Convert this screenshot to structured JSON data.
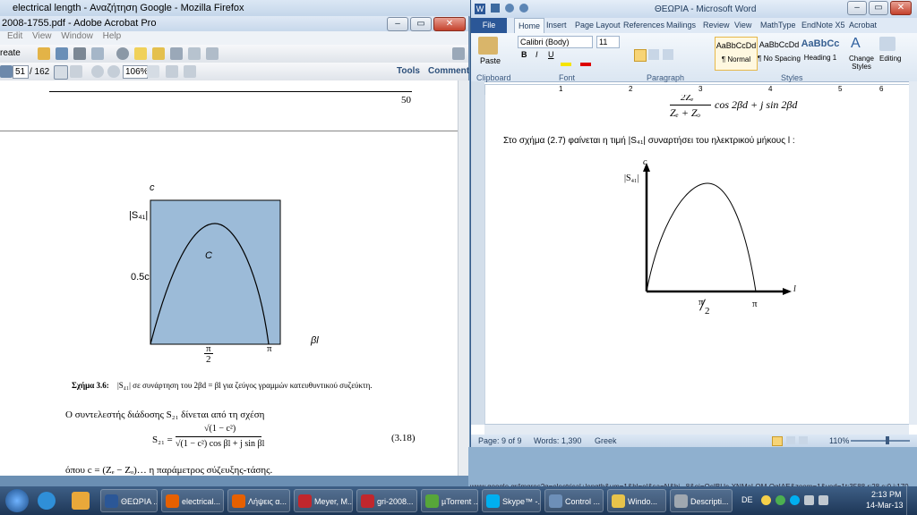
{
  "firefox": {
    "title": "electrical length - Αναζήτηση Google - Mozilla Firefox"
  },
  "acrobat": {
    "title": "2008-1755.pdf - Adobe Acrobat Pro",
    "menu": [
      "Edit",
      "View",
      "Window",
      "Help"
    ],
    "create_label": "reate",
    "page_current": "51",
    "page_total": "/ 162",
    "zoom": "106%",
    "tools_label": "Tools",
    "comment_label": "Comment",
    "page_number": "50",
    "figure": {
      "ylabel_c": "c",
      "ytick_s41": "|S₄₁|",
      "ytick_half": "0.5c",
      "curve_label": "C",
      "xtick_pi2_top": "π",
      "xtick_pi2_bottom": "2",
      "xtick_pi": "π",
      "xlabel": "βl",
      "fill_color": "#9cbbd8"
    },
    "caption_bold": "Σχήμα 3.6:",
    "caption_rest": "|S₄₁| σε συνάρτηση του  2βd = βl  για ζεύγος γραμμών κατευθυντικού συζεύκτη.",
    "para1": "Ο συντελεστής διάδοσης S₂₁ δίνεται από τη σχέση",
    "eq_lhs": "S₂₁ =",
    "eq_num": "√(1 − c²)",
    "eq_den": "√(1 − c²) cos βl + j sin βl",
    "eq_no": "(3.18)",
    "para2": "όπου  c = (Zₑ − Zₒ)…  η παράμετρος σύζευξης-τάσης."
  },
  "word": {
    "title": "ΘΕΩΡΙΑ - Microsoft Word",
    "tabs": [
      "File",
      "Home",
      "Insert",
      "Page Layout",
      "References",
      "Mailings",
      "Review",
      "View",
      "MathType",
      "EndNote X5",
      "Acrobat"
    ],
    "font_name": "Calibri (Body)",
    "font_size": "11",
    "styles": [
      {
        "preview": "AaBbCcDd",
        "name": "¶ Normal"
      },
      {
        "preview": "AaBbCcDd",
        "name": "¶ No Spacing"
      },
      {
        "preview": "AaBbCc",
        "name": "Heading 1"
      }
    ],
    "change_styles": "Change Styles",
    "editing": "Editing",
    "paste": "Paste",
    "groups": [
      "Clipboard",
      "Font",
      "Paragraph",
      "Styles"
    ],
    "ruler_nums": [
      "1",
      "2",
      "3",
      "4",
      "5",
      "6"
    ],
    "eq_top": "2Zₑ",
    "eq_den": "Zₑ + Zₒ",
    "eq_rest": "cos 2βd + j sin 2βd",
    "sentence": "Στο σχήμα (2.7) φαίνεται η τιμή |S₄₁| συναρτήσει του ηλεκτρικού μήκους l :",
    "fig_c": "c",
    "fig_s41": "|S₄₁|",
    "fig_l": "l",
    "fig_pi2_top": "π",
    "fig_pi2_bottom": "2",
    "fig_pi": "π",
    "status_page": "Page: 9 of 9",
    "status_words": "Words: 1,390",
    "status_lang": "Greek",
    "status_zoom": "110%"
  },
  "url_text": "www.google.gr/imgres?q=electrical+length&um=1&hl=el&sa=N&bi...8&ei=OcIBUc-XNMaLOM-OgIAE&zoom=1&ved=1t:3588,r:28,s:0,i:170",
  "taskbar": {
    "buttons": [
      {
        "label": "ΘΕΩΡΙΑ ...",
        "color": "#2b5797"
      },
      {
        "label": "electrical...",
        "color": "#e66000"
      },
      {
        "label": "Λήψεις α...",
        "color": "#e66000"
      },
      {
        "label": "Meyer, M...",
        "color": "#c1272d"
      },
      {
        "label": "gri-2008...",
        "color": "#c1272d"
      },
      {
        "label": "µTorrent ...",
        "color": "#57a639"
      },
      {
        "label": "Skype™ -...",
        "color": "#00aff0"
      },
      {
        "label": "Control ...",
        "color": "#6d8fb8"
      },
      {
        "label": "Windo...",
        "color": "#e8c34a"
      },
      {
        "label": "Descripti...",
        "color": "#a0a8b0"
      }
    ],
    "lang": "DE",
    "time": "2:13 PM",
    "date": "14-Mar-13"
  }
}
